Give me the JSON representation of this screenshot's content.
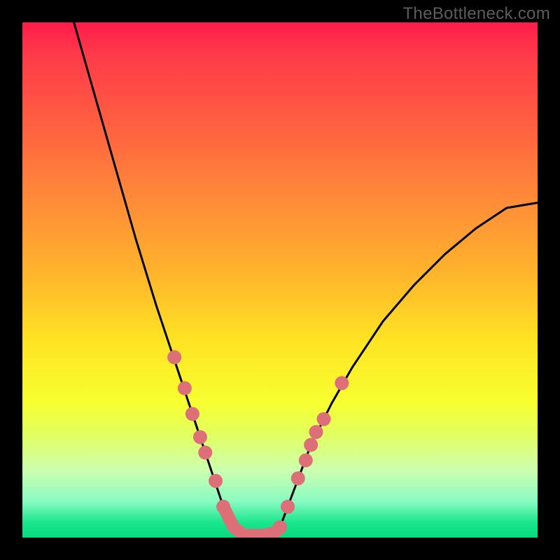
{
  "watermark": "TheBottleneck.com",
  "chart_data": {
    "type": "line",
    "title": "",
    "xlabel": "",
    "ylabel": "",
    "xlim": [
      0,
      100
    ],
    "ylim": [
      0,
      100
    ],
    "series": [
      {
        "name": "bottleneck-curve",
        "type": "line",
        "x": [
          10,
          14,
          18,
          22,
          26,
          30,
          33,
          35,
          37,
          39,
          40,
          43,
          46,
          48,
          50,
          53,
          56,
          60,
          64,
          70,
          76,
          82,
          88,
          94,
          100
        ],
        "y": [
          100,
          86,
          72,
          58,
          45,
          33,
          24,
          18,
          12,
          6,
          2,
          0,
          0,
          0,
          2,
          10,
          18,
          26,
          33,
          42,
          49,
          55,
          60,
          64,
          65
        ]
      },
      {
        "name": "left-markers",
        "type": "scatter",
        "x": [
          29.5,
          31.5,
          33,
          34.5,
          35.5,
          37.5,
          39
        ],
        "y": [
          35,
          29,
          24,
          19.5,
          16.5,
          11,
          6
        ]
      },
      {
        "name": "right-markers",
        "type": "scatter",
        "x": [
          50,
          51.5,
          53.5,
          55,
          56,
          57,
          58.5,
          62
        ],
        "y": [
          2,
          6,
          11.5,
          15,
          18,
          20.5,
          23,
          30
        ]
      },
      {
        "name": "trough-band",
        "type": "line",
        "x": [
          39,
          41,
          43,
          45,
          47,
          49,
          50
        ],
        "y": [
          6,
          2,
          0.5,
          0.5,
          0.5,
          1,
          2
        ]
      }
    ],
    "colors": {
      "curve": "#000000",
      "markers": "#dc6f78",
      "trough_band": "#dc6f78"
    }
  }
}
